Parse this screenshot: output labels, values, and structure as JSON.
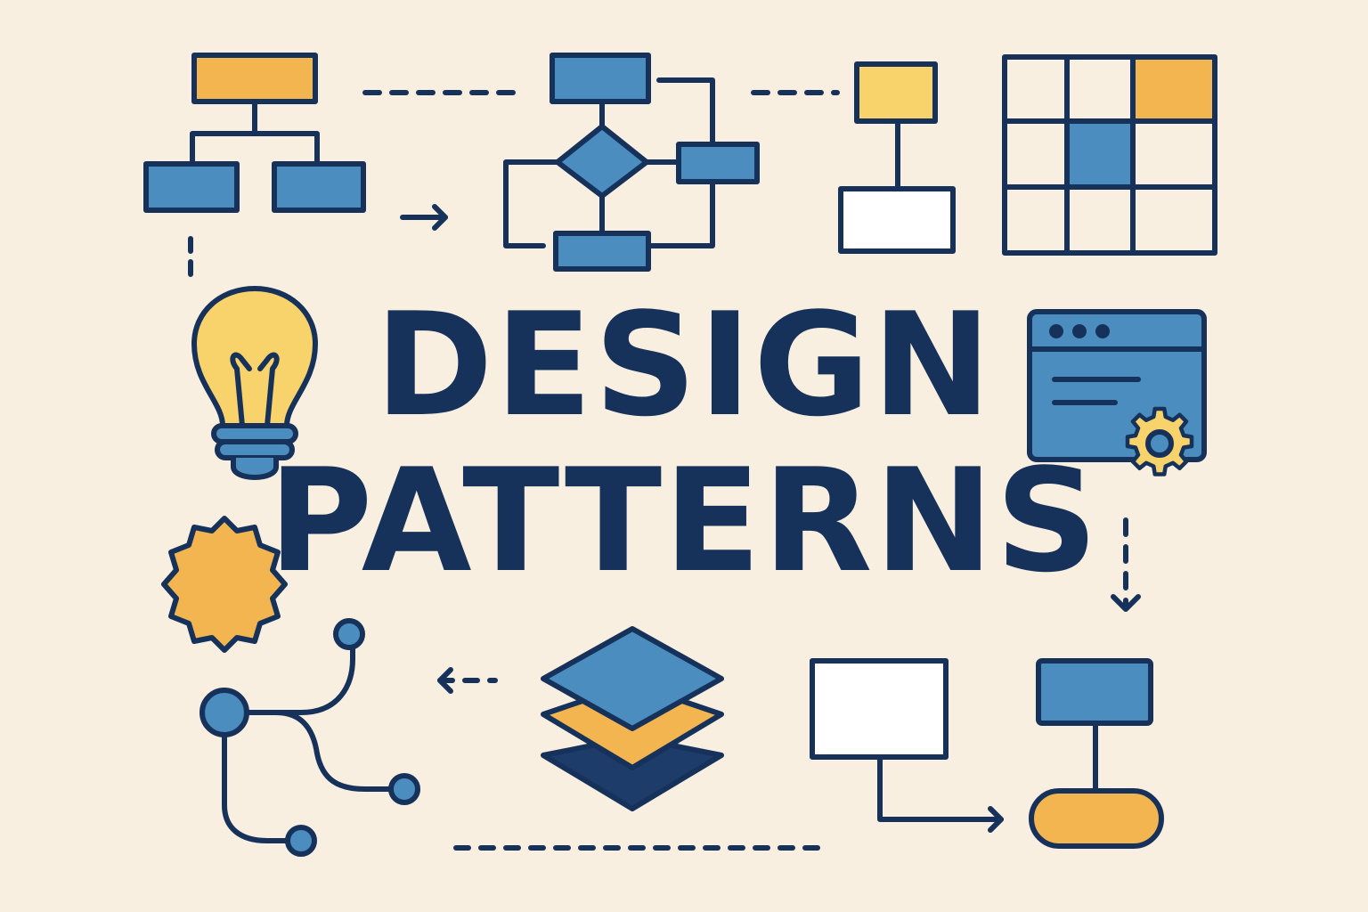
{
  "title": {
    "line1": "DESIGN",
    "line2": "PATTERNS"
  },
  "colors": {
    "background": "#f8efe0",
    "outline": "#16325b",
    "blue": "#4b8dbf",
    "orange": "#f2b54f",
    "yellow": "#f8d26a",
    "white": "#ffffff",
    "navy": "#1d3c6a"
  },
  "icons": [
    "hierarchy-tree-icon",
    "flowchart-icon",
    "connector-node-icon",
    "grid-matrix-icon",
    "lightbulb-icon",
    "browser-settings-icon",
    "gear-icon",
    "badge-seal-icon",
    "branch-network-icon",
    "layers-stack-icon",
    "process-flow-icon"
  ]
}
